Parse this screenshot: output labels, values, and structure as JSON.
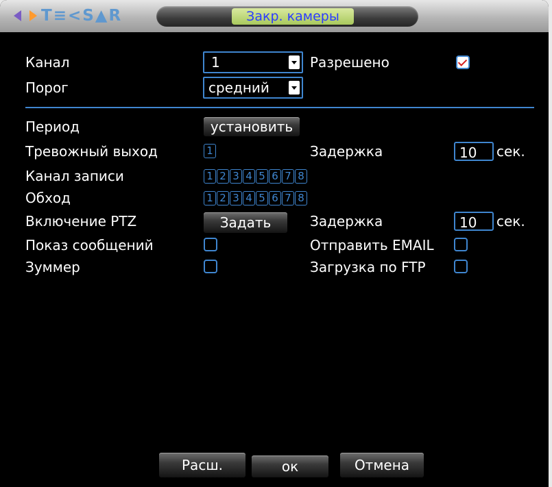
{
  "title": "Закр. камеры",
  "logo": {
    "text": "T≡<S▲R"
  },
  "top": {
    "channel_label": "Канал",
    "channel_value": "1",
    "enabled_label": "Разрешено",
    "enabled_checked": true,
    "threshold_label": "Порог",
    "threshold_value": "средний"
  },
  "period": {
    "label": "Период",
    "button": "установить"
  },
  "alarm_out": {
    "label": "Тревожный выход",
    "channels": [
      "1"
    ],
    "delay_label": "Задержка",
    "delay_value": "10",
    "unit": "сек."
  },
  "record_channel": {
    "label": "Канал записи",
    "channels": [
      "1",
      "2",
      "3",
      "4",
      "5",
      "6",
      "7",
      "8"
    ]
  },
  "tour": {
    "label": "Обход",
    "channels": [
      "1",
      "2",
      "3",
      "4",
      "5",
      "6",
      "7",
      "8"
    ]
  },
  "ptz": {
    "label": "Включение PTZ",
    "button": "Задать",
    "delay_label": "Задержка",
    "delay_value": "10",
    "unit": "сек."
  },
  "show_msg": {
    "label": "Показ сообщений",
    "checked": false
  },
  "send_email": {
    "label": "Отправить EMAIL",
    "checked": false
  },
  "buzzer": {
    "label": "Зуммер",
    "checked": false
  },
  "ftp": {
    "label": "Загрузка по FTP",
    "checked": false
  },
  "footer": {
    "adv": "Расш.",
    "ok": "ок",
    "cancel": "Отмена"
  }
}
